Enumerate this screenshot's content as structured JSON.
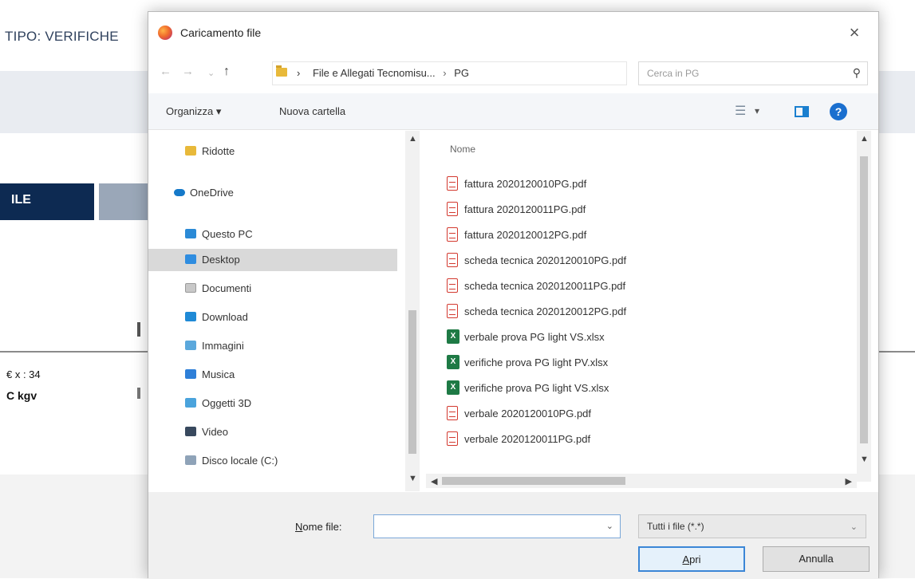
{
  "background_app": {
    "title": "TIPO: VERIFICHE",
    "file_button_label": "ILE",
    "row_cell_a": "€ x : 34",
    "row_cell_b": "C kgv"
  },
  "dialog": {
    "title": "Caricamento file",
    "close_label": "×",
    "address": {
      "crumbs": [
        "File e Allegati Tecnomisu...",
        "PG"
      ],
      "separator": "›"
    },
    "search": {
      "placeholder": "Cerca in PG"
    },
    "toolbar": {
      "organize_label": "Organizza ▾",
      "new_folder_label": "Nuova cartella",
      "help_label": "?"
    },
    "nav_items": [
      {
        "label": "Ridotte",
        "icon": "folder-icon"
      },
      {
        "label": "OneDrive",
        "icon": "cloud-icon"
      },
      {
        "label": "Questo PC",
        "icon": "pc-icon"
      },
      {
        "label": "Desktop",
        "icon": "desktop-icon",
        "selected": true
      },
      {
        "label": "Documenti",
        "icon": "documents-icon"
      },
      {
        "label": "Download",
        "icon": "download-icon"
      },
      {
        "label": "Immagini",
        "icon": "images-icon"
      },
      {
        "label": "Musica",
        "icon": "music-icon"
      },
      {
        "label": "Oggetti 3D",
        "icon": "objects-3d-icon"
      },
      {
        "label": "Video",
        "icon": "video-icon"
      },
      {
        "label": "Disco locale (C:)",
        "icon": "disk-icon"
      }
    ],
    "file_list": {
      "column_header": "Nome",
      "files": [
        {
          "name": "fattura 2020120010PG.pdf",
          "type": "pdf"
        },
        {
          "name": "fattura 2020120011PG.pdf",
          "type": "pdf"
        },
        {
          "name": "fattura 2020120012PG.pdf",
          "type": "pdf"
        },
        {
          "name": "scheda tecnica 2020120010PG.pdf",
          "type": "pdf"
        },
        {
          "name": "scheda tecnica 2020120011PG.pdf",
          "type": "pdf"
        },
        {
          "name": "scheda tecnica 2020120012PG.pdf",
          "type": "pdf"
        },
        {
          "name": "verbale prova PG light VS.xlsx",
          "type": "xlsx"
        },
        {
          "name": "verifiche prova PG light PV.xlsx",
          "type": "xlsx"
        },
        {
          "name": "verifiche prova PG light VS.xlsx",
          "type": "xlsx"
        },
        {
          "name": "verbale 2020120010PG.pdf",
          "type": "pdf"
        },
        {
          "name": "verbale 2020120011PG.pdf",
          "type": "pdf"
        }
      ]
    },
    "bottom": {
      "filename_label_access": "N",
      "filename_label_rest": "ome file:",
      "filename_value": "",
      "filetype_value": "Tutti i file (*.*)",
      "open_label_access": "A",
      "open_label_rest": "pri",
      "cancel_label": "Annulla"
    }
  }
}
